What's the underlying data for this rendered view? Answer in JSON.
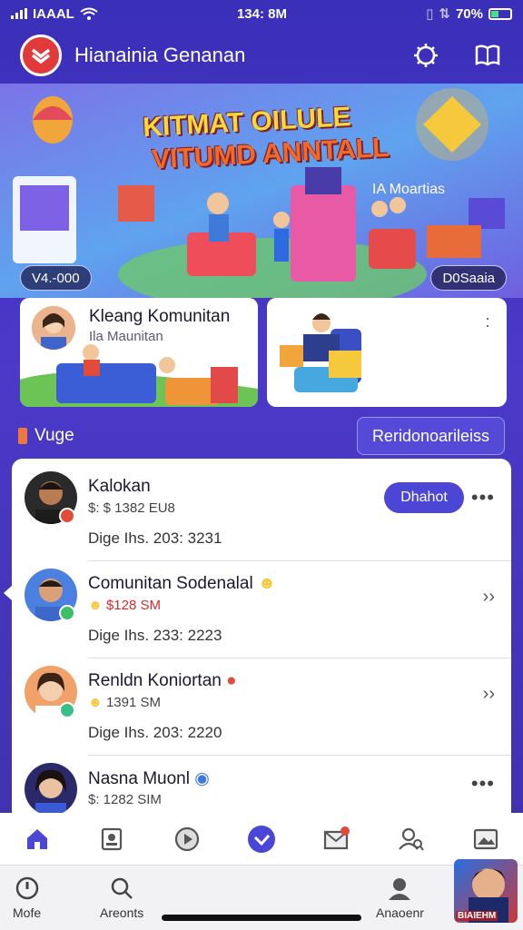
{
  "status_bar": {
    "carrier": "IAAAL",
    "time": "134: 8M",
    "battery": "70%"
  },
  "header": {
    "app_title": "Hianainia Genanan"
  },
  "hero": {
    "title_line1": "KITMAT OILULE",
    "title_line2": "VITUMD ANNTALL",
    "subtitle": "IA Moartias",
    "pill_left": "V4.-000",
    "pill_right": "D0Saaia"
  },
  "cards": [
    {
      "title": "Kleang Komunitan",
      "subtitle": "Ila Maunitan"
    },
    {
      "title": "",
      "subtitle": ""
    }
  ],
  "section": {
    "label": "Vuge",
    "button": "Reridonoarileiss"
  },
  "list": [
    {
      "name": "Kalokan",
      "meta": "$: $ 1382 EU8",
      "date": "Dige Ihs. 203: 3231",
      "action": "Dhahot",
      "badge_color": "#e24a3a"
    },
    {
      "name": "Comunitan Sodenalal",
      "meta": "$128 SM",
      "date": "Dige Ihs. 233: 2223",
      "badge_color": "#3bbf6a"
    },
    {
      "name": "Renldn Koniortan",
      "meta": "1391 SM",
      "date": "Dige Ihs. 203: 2220",
      "badge_color": "#3bbf8a"
    },
    {
      "name": "Nasna Muonl",
      "meta": "$: 1282 SIM",
      "badge_color": "#3a7ae0"
    }
  ],
  "system_nav": {
    "item1": "Mofe",
    "item2": "Areonts",
    "item3": "Anaoenr",
    "corner_caption": "BIAIEHM"
  }
}
